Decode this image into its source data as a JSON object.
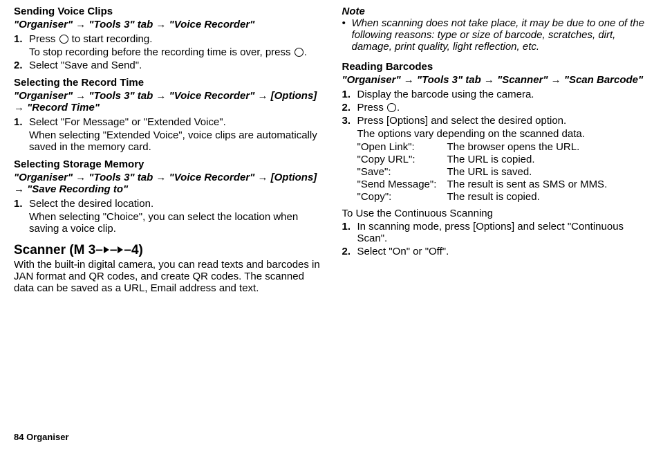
{
  "left": {
    "h1": "Sending Voice Clips",
    "nav1": "\"Organiser\" → \"Tools 3\" tab → \"Voice Recorder\"",
    "s1n": "1.",
    "s1a": "Press ",
    "s1b": " to start recording.",
    "s1da": "To stop recording before the recording time is over, press ",
    "s1db": ".",
    "s2n": "2.",
    "s2": "Select \"Save and Send\".",
    "h2": "Selecting the Record Time",
    "nav2": "\"Organiser\" → \"Tools 3\" tab → \"Voice Recorder\" → [Options] → \"Record Time\"",
    "s3n": "1.",
    "s3": "Select \"For Message\" or \"Extended Voice\".",
    "s3d": "When selecting \"Extended Voice\", voice clips are automatically saved in the memory card.",
    "h3": "Selecting Storage Memory",
    "nav3": "\"Organiser\" → \"Tools 3\" tab → \"Voice Recorder\" → [Options] → \"Save Recording to\"",
    "s4n": "1.",
    "s4": "Select the desired location.",
    "s4d": "When selecting \"Choice\", you can select the location when saving a voice clip.",
    "mhA": "Scanner ",
    "mhB": "(M 3–",
    "mhC": "–",
    "mhD": "–4)",
    "intro": "With the built-in digital camera, you can read texts and barcodes in JAN format and QR codes, and create QR codes. The scanned data can be saved as a URL, Email address and text."
  },
  "right": {
    "note_h": "Note",
    "note_b": "•",
    "note_t": "When scanning does not take place, it may be due to one of the following reasons: type or size of barcode, scratches, dirt, damage, print quality, light reflection, etc.",
    "h1": "Reading Barcodes",
    "nav1": "\"Organiser\" → \"Tools 3\" tab → \"Scanner\" → \"Scan Barcode\"",
    "s1n": "1.",
    "s1": "Display the barcode using the camera.",
    "s2n": "2.",
    "s2a": "Press ",
    "s2b": ".",
    "s3n": "3.",
    "s3": "Press [Options] and select the desired option.",
    "s3d": "The options vary depending on the scanned data.",
    "opts": [
      {
        "l": "\"Open Link\":",
        "d": "The browser opens the URL."
      },
      {
        "l": "\"Copy URL\":",
        "d": "The URL is copied."
      },
      {
        "l": "\"Save\":",
        "d": "The URL is saved."
      },
      {
        "l": "\"Send Message\":",
        "d": "The result is sent as SMS or MMS."
      },
      {
        "l": "\"Copy\":",
        "d": "The result is copied."
      }
    ],
    "h2": "To Use the Continuous Scanning",
    "s4n": "1.",
    "s4": "In scanning mode, press [Options] and select \"Continuous Scan\".",
    "s5n": "2.",
    "s5": "Select \"On\" or \"Off\"."
  },
  "footer": "84    Organiser"
}
